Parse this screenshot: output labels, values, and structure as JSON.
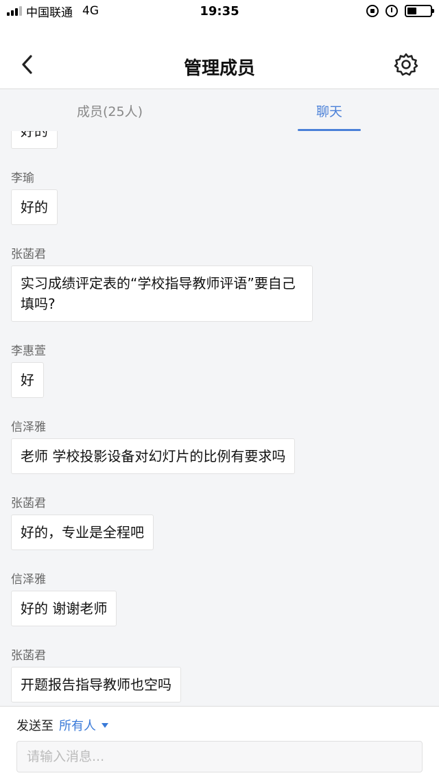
{
  "status_bar": {
    "carrier": "中国联通",
    "network": "4G",
    "time": "19:35"
  },
  "header": {
    "title": "管理成员",
    "back_icon": "chevron-left-icon",
    "settings_icon": "gear-icon"
  },
  "tabs": [
    {
      "label": "成员(25人)",
      "active": false
    },
    {
      "label": "聊天",
      "active": true
    }
  ],
  "messages": [
    {
      "sender": "",
      "text": "好的"
    },
    {
      "sender": "李瑜",
      "text": "好的"
    },
    {
      "sender": "张菡君",
      "text": "实习成绩评定表的“学校指导教师评语”要自己填吗?"
    },
    {
      "sender": "李惠萱",
      "text": "好"
    },
    {
      "sender": "信泽雅",
      "text": "老师 学校投影设备对幻灯片的比例有要求吗"
    },
    {
      "sender": "张菡君",
      "text": "好的，专业是全程吧"
    },
    {
      "sender": "信泽雅",
      "text": "好的 谢谢老师"
    },
    {
      "sender": "张菡君",
      "text": "开题报告指导教师也空吗"
    }
  ],
  "composer": {
    "send_to_label": "发送至",
    "recipient": "所有人",
    "placeholder": "请输入消息..."
  },
  "colors": {
    "accent": "#4a80d8",
    "background": "#f4f5f7"
  }
}
